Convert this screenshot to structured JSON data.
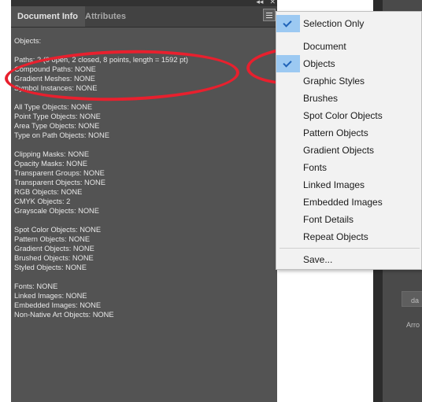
{
  "panel": {
    "tabs": [
      {
        "label": "Document Info"
      },
      {
        "label": "Attributes"
      }
    ],
    "controls": {
      "collapse": "◂◂",
      "close": "✕"
    },
    "lines": [
      "Objects:",
      "",
      "Paths: 2 (0 open, 2 closed, 8 points, length = 1592 pt)",
      "Compound Paths: NONE",
      "Gradient Meshes: NONE",
      "Symbol Instances: NONE",
      "",
      "All Type Objects: NONE",
      "Point Type Objects: NONE",
      "Area Type Objects: NONE",
      "Type on Path Objects: NONE",
      "",
      "Clipping Masks: NONE",
      "Opacity Masks: NONE",
      "Transparent Groups: NONE",
      "Transparent Objects: NONE",
      "RGB Objects: NONE",
      "CMYK Objects: 2",
      "Grayscale Objects: NONE",
      "",
      "Spot Color Objects: NONE",
      "Pattern Objects: NONE",
      "Gradient Objects: NONE",
      "Brushed Objects: NONE",
      "Styled Objects: NONE",
      "",
      "Fonts: NONE",
      "Linked Images: NONE",
      "Embedded Images: NONE",
      "Non-Native Art Objects: NONE"
    ]
  },
  "menu": {
    "items": [
      {
        "label": "Selection Only",
        "checked": true
      },
      {
        "label": "Document",
        "checked": false
      },
      {
        "label": "Objects",
        "checked": true
      },
      {
        "label": "Graphic Styles",
        "checked": false
      },
      {
        "label": "Brushes",
        "checked": false
      },
      {
        "label": "Spot Color Objects",
        "checked": false
      },
      {
        "label": "Pattern Objects",
        "checked": false
      },
      {
        "label": "Gradient Objects",
        "checked": false
      },
      {
        "label": "Fonts",
        "checked": false
      },
      {
        "label": "Linked Images",
        "checked": false
      },
      {
        "label": "Embedded Images",
        "checked": false
      },
      {
        "label": "Font Details",
        "checked": false
      },
      {
        "label": "Repeat Objects",
        "checked": false
      },
      {
        "label": "Save...",
        "checked": false
      }
    ]
  },
  "background": {
    "labels": [
      "da",
      "Arro"
    ]
  },
  "colors": {
    "panel": "#535353",
    "annotation": "#e8202e",
    "check_highlight": "#9cc9f2"
  }
}
